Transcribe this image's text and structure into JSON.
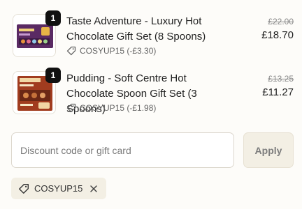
{
  "items": [
    {
      "quantity": "1",
      "title": "Taste Adventure - Luxury Hot Chocolate Gift Set (8 Spoons)",
      "discount_text": "COSYUP15 (-£3.30)",
      "original_price": "£22.00",
      "price": "£18.70"
    },
    {
      "quantity": "1",
      "title": "Pudding - Soft Centre Hot Chocolate Spoon Gift Set (3 Spoons)",
      "discount_text": "COSYUP15 (-£1.98)",
      "original_price": "£13.25",
      "price": "£11.27"
    }
  ],
  "discount_form": {
    "placeholder": "Discount code or gift card",
    "value": "",
    "apply_label": "Apply"
  },
  "applied_code": {
    "code": "COSYUP15"
  },
  "colors": {
    "background": "#fdfcf9",
    "badge": "#111111",
    "button_bg": "#f3efe4",
    "chip_bg": "#f3efe4",
    "border": "#dcd7cd"
  },
  "icons": {
    "discount": "tag-icon",
    "remove": "close-icon"
  }
}
